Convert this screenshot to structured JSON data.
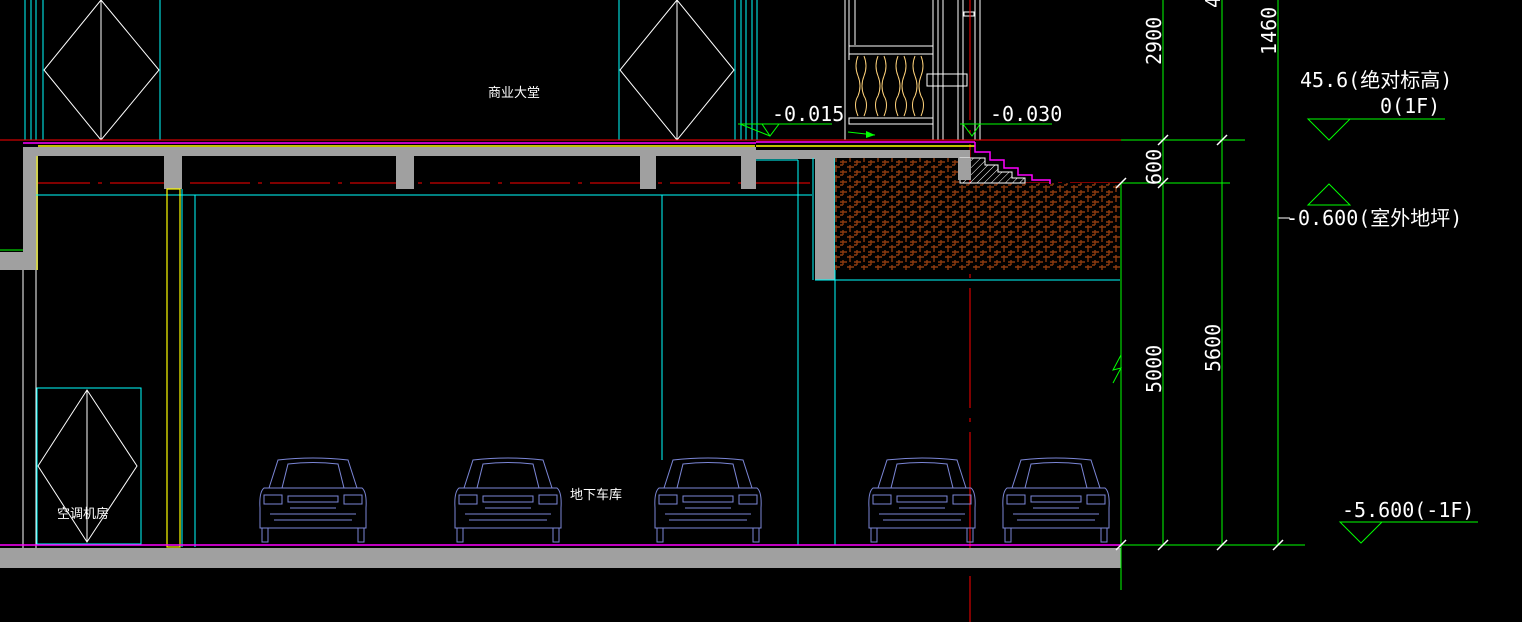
{
  "rooms": {
    "lobby": "商业大堂",
    "garage": "地下车库",
    "ac_room": "空调机房"
  },
  "levels": {
    "l1": "-0.015",
    "l2": "-0.030",
    "abs": "45.6(绝对标高)",
    "f1": "0(1F)",
    "outdoor": "-0.600(室外地坪)",
    "b1": "-5.600(-1F)"
  },
  "dims": {
    "d2900": "2900",
    "d600": "600",
    "d5000": "5000",
    "d5600": "5600",
    "d1460": "1460",
    "d4": "4"
  },
  "colors": {
    "cyan": "#00ffff",
    "yellow": "#ffff00",
    "magenta": "#ff00ff",
    "red": "#ff0000",
    "green": "#00ff00",
    "slab": "#a0a0a0",
    "soil": "#8b3a0f",
    "car": "#7b86d6"
  }
}
